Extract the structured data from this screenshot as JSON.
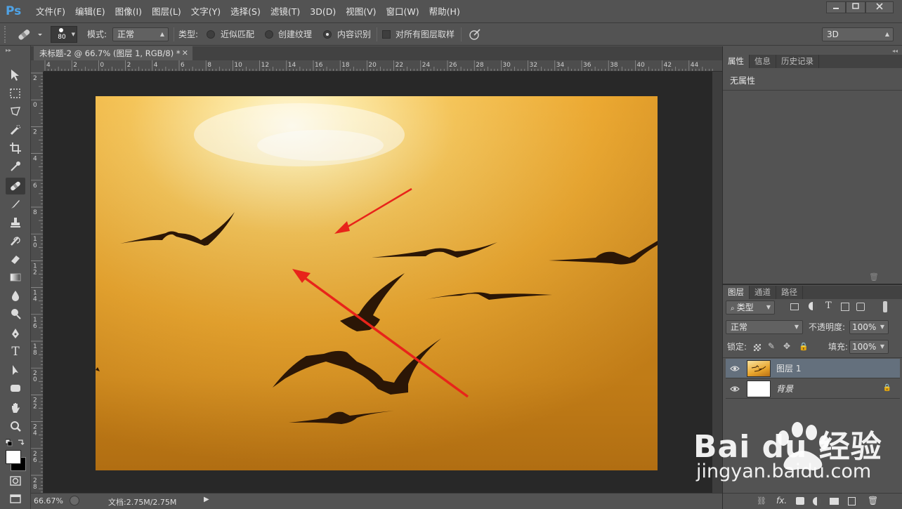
{
  "app": {
    "logo": "Ps",
    "menu": [
      "文件(F)",
      "编辑(E)",
      "图像(I)",
      "图层(L)",
      "文字(Y)",
      "选择(S)",
      "滤镜(T)",
      "3D(D)",
      "视图(V)",
      "窗口(W)",
      "帮助(H)"
    ],
    "window_controls": [
      "minimize-icon",
      "maximize-icon",
      "close-icon"
    ]
  },
  "options": {
    "brush_size": "80",
    "mode_label": "模式:",
    "mode_value": "正常",
    "type_label": "类型:",
    "radio_1": "近似匹配",
    "radio_2": "创建纹理",
    "radio_3": "内容识别",
    "selected_radio": "内容识别",
    "sample_all_layers": "对所有图层取样",
    "workspace": "3D"
  },
  "document": {
    "tab_title": "未标题-2 @ 66.7% (图层 1, RGB/8) *",
    "ruler_h_labels": [
      "4",
      "2",
      "0",
      "2",
      "4",
      "6",
      "8",
      "10",
      "12",
      "14",
      "16",
      "18",
      "20",
      "22",
      "24",
      "26",
      "28",
      "30",
      "32",
      "34",
      "36",
      "38",
      "40",
      "42",
      "44"
    ],
    "ruler_v_labels": [
      "2",
      "0",
      "2",
      "4",
      "6",
      "8",
      "10",
      "12",
      "14",
      "16",
      "18",
      "20",
      "22",
      "24",
      "26",
      "28"
    ],
    "zoom": "66.67%",
    "doc_size": "文档:2.75M/2.75M"
  },
  "panels": {
    "top_tabs": [
      "属性",
      "信息",
      "历史记录"
    ],
    "properties_text": "无属性",
    "layers_tabs": [
      "图层",
      "通道",
      "路径"
    ],
    "filter_label": "类型",
    "blend_mode": "正常",
    "opacity_label": "不透明度:",
    "opacity_value": "100%",
    "lock_label": "锁定:",
    "fill_label": "填充:",
    "fill_value": "100%",
    "layers": [
      {
        "name": "图层 1",
        "selected": true
      },
      {
        "name": "背景",
        "selected": false
      }
    ]
  },
  "watermark": {
    "brand": "Bai du 经验",
    "url": "jingyan.baidu.com"
  },
  "colors": {
    "ui_bg": "#535353",
    "canvas_bg": "#282828",
    "accent_selected": "#64707d",
    "arrow": "#e8241a",
    "sky_top": "#fff6d8",
    "sky_mid": "#f3b640",
    "sky_bottom": "#c8821a"
  }
}
